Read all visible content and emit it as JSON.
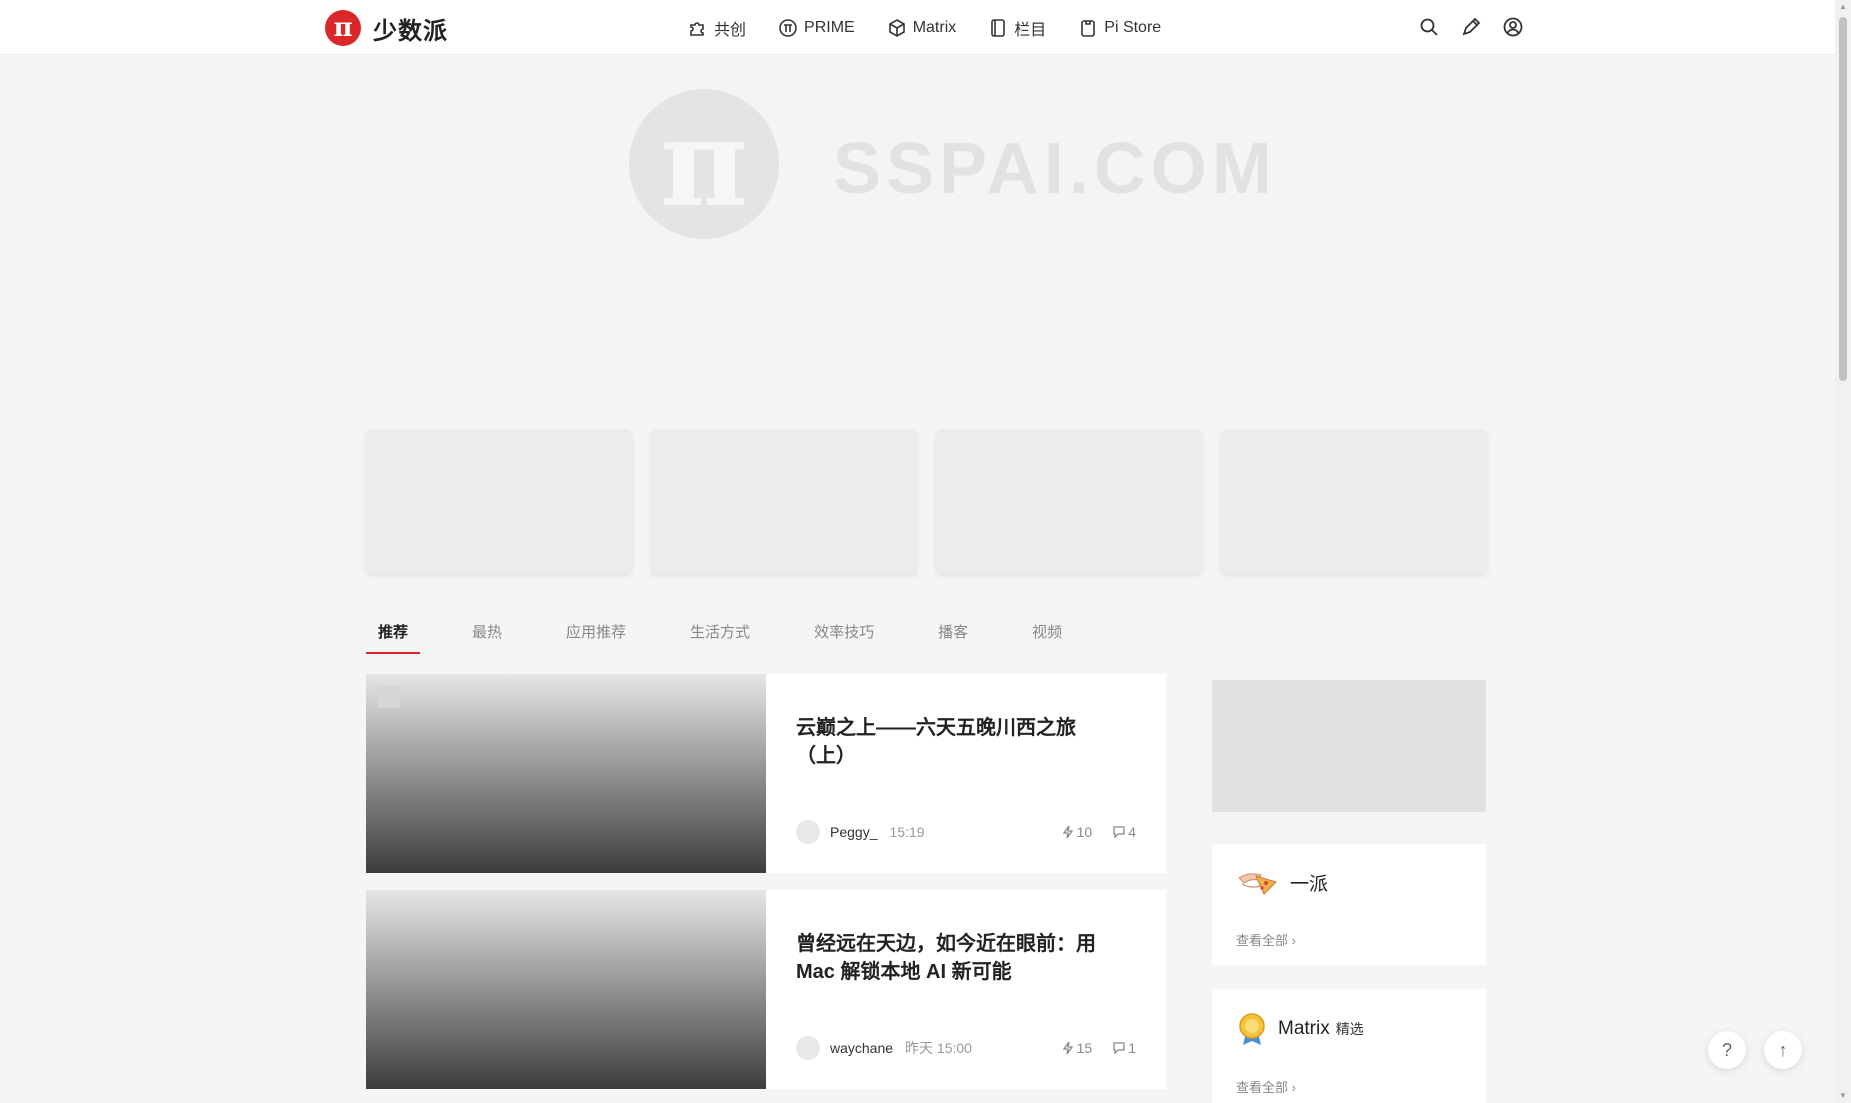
{
  "brand": {
    "logo_glyph": "π",
    "name": "少数派",
    "accent": "#da282a"
  },
  "nav": [
    {
      "label": "共创",
      "icon": "puzzle-icon"
    },
    {
      "label": "PRIME",
      "icon": "prime-icon"
    },
    {
      "label": "Matrix",
      "icon": "matrix-icon"
    },
    {
      "label": "栏目",
      "icon": "book-icon"
    },
    {
      "label": "Pi Store",
      "icon": "store-icon"
    }
  ],
  "toolbar": {
    "icons": [
      "search-icon",
      "pen-icon",
      "user-icon"
    ]
  },
  "hero": {
    "glyph": "π",
    "text": "SSPAI.COM"
  },
  "tabs": [
    "推荐",
    "最热",
    "应用推荐",
    "生活方式",
    "效率技巧",
    "播客",
    "视频"
  ],
  "articles": [
    {
      "title": "云巅之上——六天五晚川西之旅（上）",
      "author": "Peggy_",
      "time": "15:19",
      "likes": "10",
      "comments": "4"
    },
    {
      "title": "曾经远在天边，如今近在眼前：用 Mac 解锁本地 AI 新可能",
      "author": "waychane",
      "time": "昨天 15:00",
      "likes": "15",
      "comments": "1"
    }
  ],
  "sidebar": {
    "yipai": {
      "title": "一派",
      "link": "查看全部 ›"
    },
    "matrix": {
      "title": "Matrix",
      "subtitle": "精选",
      "link": "查看全部 ›"
    }
  },
  "fab": {
    "help": "?",
    "top": "↑"
  }
}
